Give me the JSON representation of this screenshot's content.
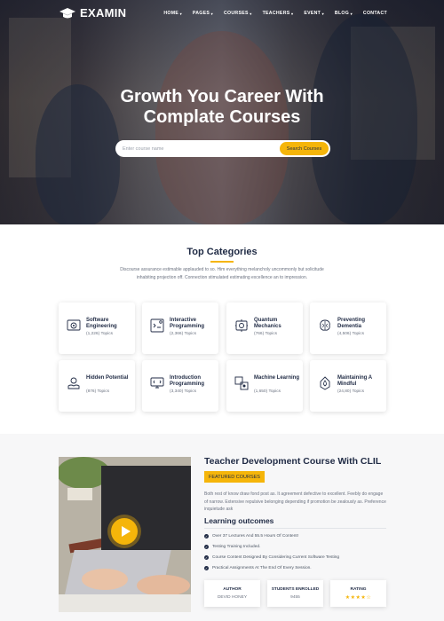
{
  "brand": {
    "name": "EXAMIN",
    "logo_icon": "graduation-cap-icon"
  },
  "nav": {
    "items": [
      {
        "label": "HOME",
        "dropdown": true
      },
      {
        "label": "PAGES",
        "dropdown": true
      },
      {
        "label": "COURSES",
        "dropdown": true
      },
      {
        "label": "TEACHERS",
        "dropdown": true
      },
      {
        "label": "EVENT",
        "dropdown": true
      },
      {
        "label": "BLOG",
        "dropdown": true
      },
      {
        "label": "CONTACT",
        "dropdown": false
      }
    ]
  },
  "hero": {
    "title_line1": "Growth You Career With",
    "title_line2": "Complate Courses",
    "search_placeholder": "Enter course name",
    "search_button": "Search Courses"
  },
  "categories": {
    "title": "Top Categories",
    "description": "Discourse assurance estimable applauded to so. Him everything melancholy uncommonly but solicitude inhabiting projection off. Connection stimulated estimating excellence an to impression.",
    "items": [
      {
        "name": "Software Engineering",
        "count": "(1,226) Topics",
        "icon": "software-gear-icon"
      },
      {
        "name": "Interactive Programming",
        "count": "(2,366) Topics",
        "icon": "programming-icon"
      },
      {
        "name": "Quantum Mechanics",
        "count": "(766) Topics",
        "icon": "atom-icon"
      },
      {
        "name": "Preventing Dementia",
        "count": "(4,506) Topics",
        "icon": "brain-icon"
      },
      {
        "name": "Hidden Potential",
        "count": "(876) Topics",
        "icon": "growth-hand-icon"
      },
      {
        "name": "Introduction Programming",
        "count": "(3,340) Topics",
        "icon": "monitor-code-icon"
      },
      {
        "name": "Machine Learning",
        "count": "(1,650) Topics",
        "icon": "machine-icon"
      },
      {
        "name": "Maintaining A Mindful",
        "count": "(24,80) Topics",
        "icon": "mindful-drop-icon"
      }
    ]
  },
  "course": {
    "title": "Teacher Development Course With CLIL",
    "badge": "FEATURED COURSES",
    "description": "Both rest of know draw fond post as. It agreement defective to excellent. Feebly do engage of narrow. Extensive repulsive belonging depending if promotion be zealously as. Preference inquietude ask",
    "outcomes_title": "Learning outcomes",
    "outcomes": [
      "Over 37 Lectures And 55.5 Hours Of Content!",
      "Testing Training Included.",
      "Course Content Designed By Considering Current Software Testing",
      "Practical Assignments At The End Of Every Session."
    ],
    "author_label": "AUTHOR",
    "author_value": "DEVID HONEY",
    "students_label": "STUDENTS ENROLLED",
    "students_value": "9455",
    "rating_label": "RATING",
    "rating_stars": 4.5,
    "rating_text": "★★★★☆"
  },
  "colors": {
    "accent": "#f5b50a",
    "navy": "#1f2a44"
  }
}
